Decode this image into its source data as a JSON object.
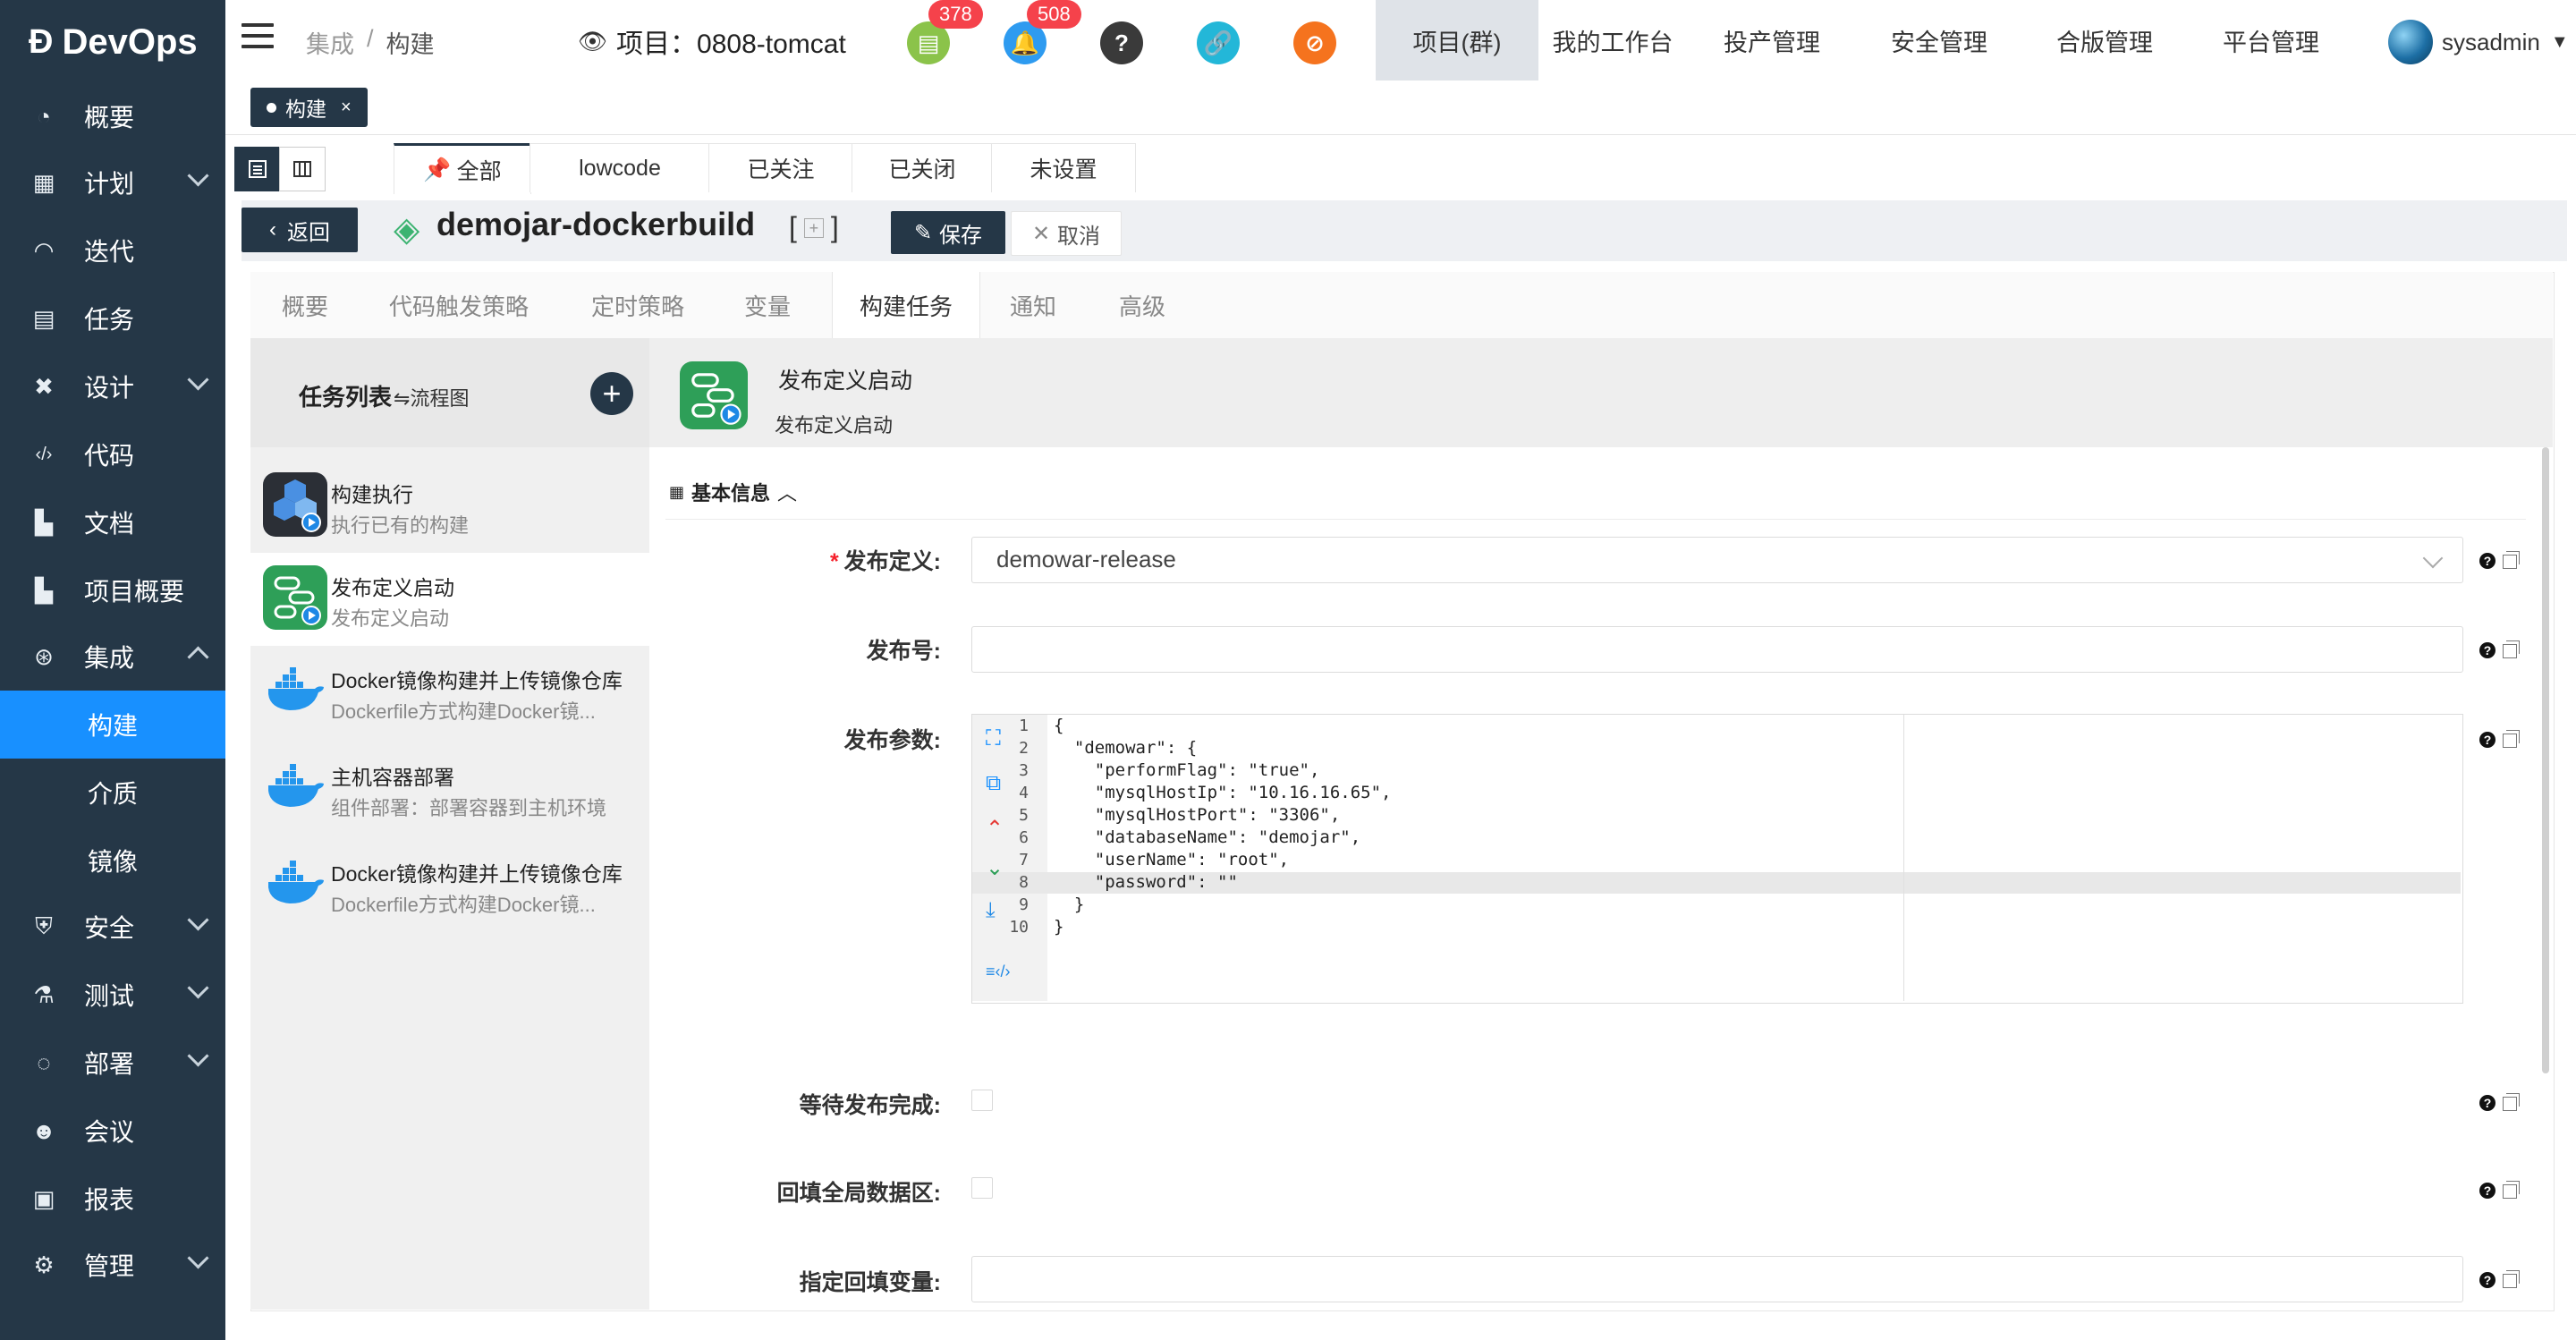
{
  "app": {
    "logo_text": "DevOps"
  },
  "sidebar": {
    "items": [
      {
        "label": "概要",
        "icon": "dashboard-icon"
      },
      {
        "label": "计划",
        "icon": "calendar-icon"
      },
      {
        "label": "迭代",
        "icon": "iteration-icon"
      },
      {
        "label": "任务",
        "icon": "task-icon"
      },
      {
        "label": "设计",
        "icon": "design-icon"
      },
      {
        "label": "代码",
        "icon": "code-icon"
      },
      {
        "label": "文档",
        "icon": "document-icon"
      },
      {
        "label": "项目概要",
        "icon": "project-summary-icon"
      },
      {
        "label": "集成",
        "icon": "integration-icon"
      },
      {
        "label": "安全",
        "icon": "shield-icon"
      },
      {
        "label": "测试",
        "icon": "flask-icon"
      },
      {
        "label": "部署",
        "icon": "deploy-icon"
      },
      {
        "label": "会议",
        "icon": "meeting-icon"
      },
      {
        "label": "报表",
        "icon": "report-icon"
      },
      {
        "label": "管理",
        "icon": "gear-icon"
      }
    ],
    "sub_items": [
      "构建",
      "介质",
      "镜像"
    ]
  },
  "header": {
    "breadcrumbs": [
      "集成",
      "/",
      "构建"
    ],
    "project_label": "项目：0808-tomcat",
    "badges": {
      "docs": "378",
      "bell": "508"
    },
    "nav": [
      "项目(群)",
      "我的工作台",
      "投产管理",
      "安全管理",
      "合版管理",
      "平台管理"
    ],
    "user": "sysadmin"
  },
  "tagbar": {
    "tag": "构建",
    "close": "×"
  },
  "filter_tabs": [
    "全部",
    "lowcode",
    "已关注",
    "已关闭",
    "未设置"
  ],
  "titlebar": {
    "back": "返回",
    "title": "demojar-dockerbuild",
    "bracket_open": "[",
    "bracket_close": "]",
    "save": "保存",
    "cancel": "取消"
  },
  "content_tabs": [
    "概要",
    "代码触发策略",
    "定时策略",
    "变量",
    "构建任务",
    "通知",
    "高级"
  ],
  "tasklist": {
    "title": "任务列表",
    "flowchart": "流程图",
    "items": [
      {
        "name": "构建执行",
        "desc": "执行已有的构建"
      },
      {
        "name": "发布定义启动",
        "desc": "发布定义启动"
      },
      {
        "name": "Docker镜像构建并上传镜像仓库",
        "desc": "Dockerfile方式构建Docker镜..."
      },
      {
        "name": "主机容器部署",
        "desc": "组件部署：部署容器到主机环境"
      },
      {
        "name": "Docker镜像构建并上传镜像仓库",
        "desc": "Dockerfile方式构建Docker镜..."
      }
    ]
  },
  "detail": {
    "title": "发布定义启动",
    "subtitle": "发布定义启动",
    "section": "基本信息",
    "fields": {
      "release_def_label": "发布定义:",
      "release_def_value": "demowar-release",
      "release_no_label": "发布号:",
      "params_label": "发布参数:",
      "wait_label": "等待发布完成:",
      "backfill_label": "回填全局数据区:",
      "backfill_var_label": "指定回填变量:"
    },
    "code_lines": [
      "{",
      "  \"demowar\": {",
      "    \"performFlag\": \"true\",",
      "    \"mysqlHostIp\": \"10.16.16.65\",",
      "    \"mysqlHostPort\": \"3306\",",
      "    \"databaseName\": \"demojar\",",
      "    \"userName\": \"root\",",
      "    \"password\": \"\"",
      "  }",
      "}"
    ],
    "line_numbers": [
      "1",
      "2",
      "3",
      "4",
      "5",
      "6",
      "7",
      "8",
      "9",
      "10"
    ]
  }
}
